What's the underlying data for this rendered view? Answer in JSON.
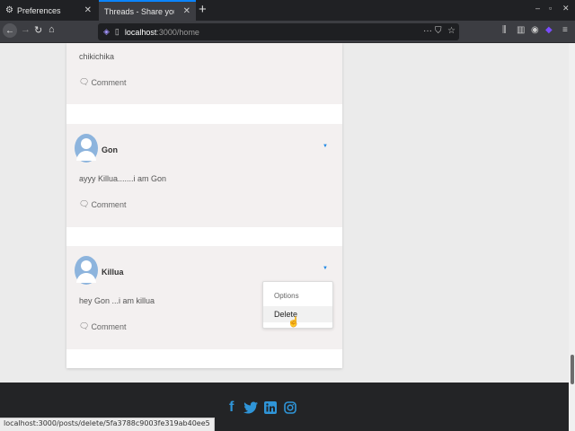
{
  "browser": {
    "tabs": [
      {
        "title": "Preferences",
        "icon": "gear-icon"
      },
      {
        "title": "Threads - Share your thoughts",
        "icon": "page-icon"
      }
    ],
    "url_host": "localhost",
    "url_path": ":3000/home",
    "status_url": "localhost:3000/posts/delete/5fa3788c9003fe319ab40ee5"
  },
  "posts": [
    {
      "author": "",
      "content": "chikichika",
      "comment_label": "Comment"
    },
    {
      "author": "Gon",
      "content": "ayyy Killua.......i am Gon",
      "comment_label": "Comment"
    },
    {
      "author": "Killua",
      "content": "hey Gon ...i am killua",
      "comment_label": "Comment"
    }
  ],
  "dropdown": {
    "header": "Options",
    "items": [
      "Delete"
    ]
  },
  "footer": {
    "social": [
      "facebook-icon",
      "twitter-icon",
      "linkedin-icon",
      "instagram-icon"
    ]
  },
  "colors": {
    "accent": "#1e88e5",
    "social": "#2f95d8",
    "footer_bg": "#232426"
  }
}
